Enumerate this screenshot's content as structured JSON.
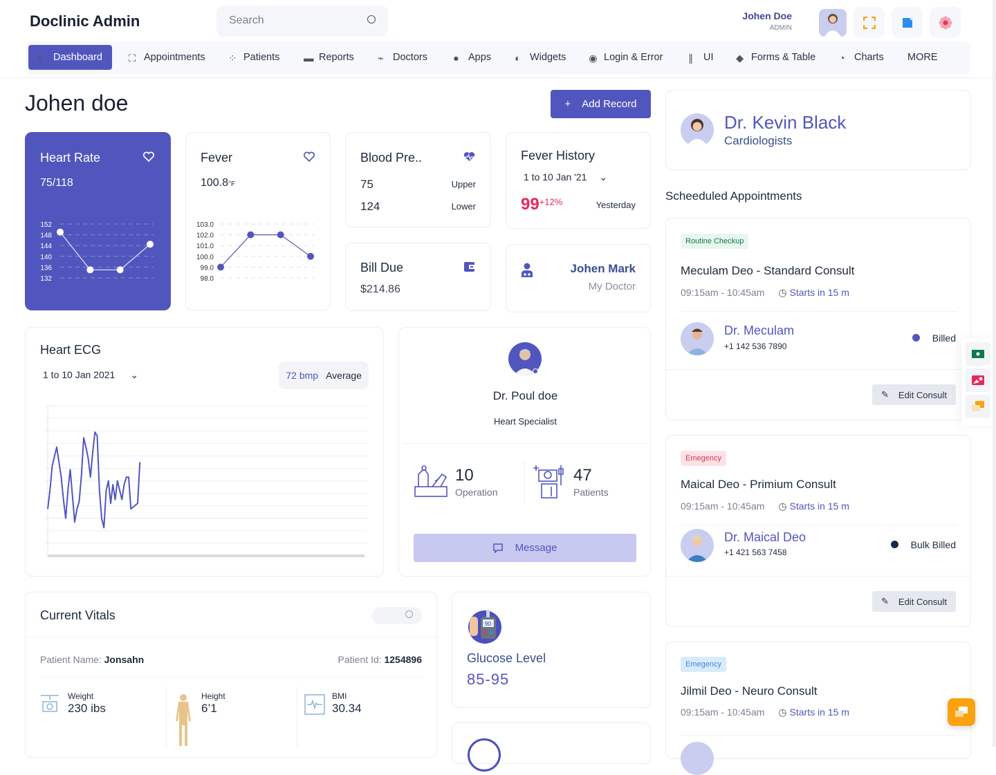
{
  "header": {
    "brand": "Doclinic Admin",
    "search_placeholder": "Search",
    "user_name": "Johen Doe",
    "user_role": "ADMIN",
    "icons": [
      "fullscreen-icon",
      "notification-icon",
      "settings-flower-icon"
    ]
  },
  "nav": {
    "items": [
      {
        "label": "Dashboard",
        "icon": "dashboard-icon",
        "active": true
      },
      {
        "label": "Appointments",
        "icon": "appointments-icon"
      },
      {
        "label": "Patients",
        "icon": "patients-icon"
      },
      {
        "label": "Reports",
        "icon": "reports-icon"
      },
      {
        "label": "Doctors",
        "icon": "doctors-icon"
      },
      {
        "label": "Apps",
        "icon": "apps-icon"
      },
      {
        "label": "Widgets",
        "icon": "widgets-icon"
      },
      {
        "label": "Login & Error",
        "icon": "login-icon"
      },
      {
        "label": "UI",
        "icon": "ui-icon"
      },
      {
        "label": "Forms & Table",
        "icon": "forms-icon"
      },
      {
        "label": "Charts",
        "icon": "charts-icon"
      },
      {
        "label": "MORE",
        "icon": ""
      }
    ]
  },
  "page": {
    "title": "Johen doe",
    "add_record": "Add Record"
  },
  "heart_rate": {
    "title": "Heart Rate",
    "value": "75/118"
  },
  "fever": {
    "title": "Fever",
    "value": "100.8",
    "unit": "°F"
  },
  "blood_pressure": {
    "title": "Blood Pre..",
    "upper_value": "75",
    "upper_label": "Upper",
    "lower_value": "124",
    "lower_label": "Lower"
  },
  "fever_history": {
    "title": "Fever History",
    "range": "1 to 10 Jan '21",
    "value": "99",
    "change": "+12%",
    "when": "Yesterday"
  },
  "bill_due": {
    "title": "Bill Due",
    "amount": "$214.86"
  },
  "my_doctor": {
    "name": "Johen Mark",
    "label": "My Doctor"
  },
  "ecg": {
    "title": "Heart ECG",
    "range": "1 to 10 Jan 2021",
    "bpm": "72 bmp",
    "bpm_label": "Average"
  },
  "doctor_profile": {
    "name": "Dr. Poul doe",
    "specialty": "Heart Specialist",
    "operations": "10",
    "operations_label": "Operation",
    "patients": "47",
    "patients_label": "Patients",
    "message": "Message"
  },
  "vitals": {
    "title": "Current Vitals",
    "patient_name_label": "Patient Name:",
    "patient_name": "Jonsahn",
    "patient_id_label": "Patient Id:",
    "patient_id": "1254896",
    "weight_label": "Weight",
    "weight": "230 ibs",
    "height_label": "Height",
    "height": "6’1",
    "bmi_label": "BMI",
    "bmi": "30.34"
  },
  "glucose": {
    "title": "Glucose Level",
    "value": "85-95"
  },
  "right": {
    "doctor_name": "Dr. Kevin Black",
    "doctor_role": "Cardiologists",
    "scheduled_title": "Scheeduled Appointments",
    "appointments": [
      {
        "tag": "Routine Checkup",
        "tag_color": "#0f7a4a",
        "tag_bg": "#e8f6ef",
        "title": "Meculam Deo - Standard Consult",
        "time": "09:15am - 10:45am",
        "starts": "Starts in 15 m",
        "doctor": "Dr. Meculam",
        "phone": "+1 142 536 7890",
        "status": "Billed",
        "status_color": "#5156be",
        "edit": "Edit Consult"
      },
      {
        "tag": "Emegency",
        "tag_color": "#d6365b",
        "tag_bg": "#fde1e6",
        "title": "Maical Deo - Primium Consult",
        "time": "09:15am - 10:45am",
        "starts": "Starts in 15 m",
        "doctor": "Dr. Maical Deo",
        "phone": "+1 421 563 7458",
        "status": "Bulk Billed",
        "status_color": "#172b4d",
        "edit": "Edit Consult"
      },
      {
        "tag": "Emegency",
        "tag_color": "#3b8bd6",
        "tag_bg": "#d9ebfb",
        "title": "Jilmil Deo - Neuro Consult",
        "time": "09:15am - 10:45am",
        "starts": "Starts in 15 m"
      }
    ]
  },
  "chart_data": [
    {
      "type": "line",
      "title": "Heart Rate",
      "x": [
        1,
        2,
        3,
        4
      ],
      "values": [
        149,
        135,
        135,
        144.5
      ],
      "yticks": [
        152,
        148,
        144,
        140,
        136,
        132
      ],
      "ylim": [
        132,
        152
      ],
      "grid": true
    },
    {
      "type": "line",
      "title": "Fever",
      "x": [
        1,
        2,
        3,
        4
      ],
      "values": [
        99.0,
        102.0,
        102.0,
        100.0
      ],
      "yticks": [
        "103.0",
        "102.0",
        "101.0",
        "100.0",
        "99.0",
        "98.0"
      ],
      "ylim": [
        98,
        103
      ],
      "grid": true
    },
    {
      "type": "line",
      "title": "Heart ECG",
      "values": [
        45,
        55,
        68,
        73,
        78,
        70,
        62,
        50,
        40,
        55,
        66,
        52,
        38,
        45,
        49,
        63,
        83,
        78,
        72,
        62,
        75,
        86,
        84,
        55,
        40,
        35,
        55,
        60,
        48,
        58,
        50,
        60,
        55,
        50,
        58,
        62,
        62,
        45,
        46,
        47,
        48,
        70
      ],
      "ylim": [
        20,
        100
      ],
      "grid": true
    }
  ]
}
